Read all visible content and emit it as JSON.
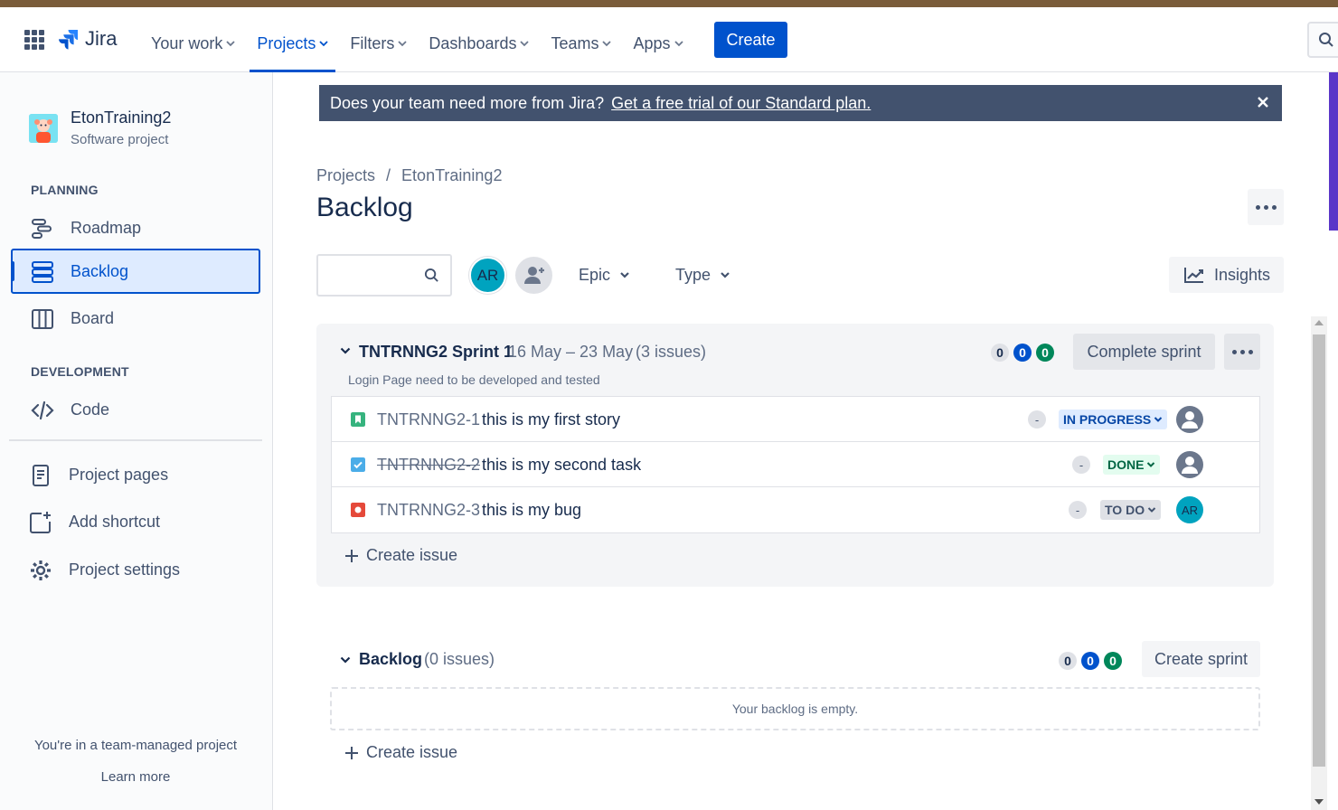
{
  "nav": {
    "logo": "Jira",
    "items": [
      {
        "label": "Your work",
        "active": false
      },
      {
        "label": "Projects",
        "active": true
      },
      {
        "label": "Filters",
        "active": false
      },
      {
        "label": "Dashboards",
        "active": false
      },
      {
        "label": "Teams",
        "active": false
      },
      {
        "label": "Apps",
        "active": false
      }
    ],
    "create_label": "Create"
  },
  "sidebar": {
    "project_name": "EtonTraining2",
    "project_type": "Software project",
    "planning_title": "PLANNING",
    "planning_items": [
      {
        "label": "Roadmap",
        "icon": "roadmap-icon",
        "active": false
      },
      {
        "label": "Backlog",
        "icon": "backlog-icon",
        "active": true
      },
      {
        "label": "Board",
        "icon": "board-icon",
        "active": false
      }
    ],
    "development_title": "DEVELOPMENT",
    "development_items": [
      {
        "label": "Code",
        "icon": "code-icon"
      }
    ],
    "extra_items": [
      {
        "label": "Project pages",
        "icon": "pages-icon"
      },
      {
        "label": "Add shortcut",
        "icon": "add-shortcut-icon"
      },
      {
        "label": "Project settings",
        "icon": "gear-icon"
      }
    ],
    "footer_text": "You're in a team-managed project",
    "learn_more": "Learn more"
  },
  "banner": {
    "text": "Does your team need more from Jira?",
    "link": "Get a free trial of our Standard plan."
  },
  "breadcrumb": [
    "Projects",
    "EtonTraining2"
  ],
  "page_title": "Backlog",
  "filters": {
    "search_placeholder": "",
    "avatar_initials": "AR",
    "epic_label": "Epic",
    "type_label": "Type",
    "insights_label": "Insights"
  },
  "sprint": {
    "name": "TNTRNNG2 Sprint 1",
    "dates": "16 May – 23 May",
    "count": "(3 issues)",
    "goal": "Login Page need to be developed and tested",
    "badge_todo": "0",
    "badge_inprogress": "0",
    "badge_done": "0",
    "complete_label": "Complete sprint",
    "issues": [
      {
        "key": "TNTRNNG2-1",
        "summary": "this is my first story",
        "type": "story",
        "estimate": "-",
        "status": "IN PROGRESS",
        "assignee": ""
      },
      {
        "key": "TNTRNNG2-2",
        "summary": "this is my second task",
        "type": "task",
        "estimate": "-",
        "status": "DONE",
        "assignee": ""
      },
      {
        "key": "TNTRNNG2-3",
        "summary": "this is my bug",
        "type": "bug",
        "estimate": "-",
        "status": "TO DO",
        "assignee": "AR"
      }
    ],
    "create_issue_label": "Create issue"
  },
  "backlog": {
    "name": "Backlog",
    "count": "(0 issues)",
    "badge_todo": "0",
    "badge_inprogress": "0",
    "badge_done": "0",
    "create_sprint_label": "Create sprint",
    "empty_text": "Your backlog is empty.",
    "create_issue_label": "Create issue"
  },
  "colors": {
    "brand": "#0052cc",
    "banner": "#42526e",
    "inprogress_bg": "#deebff",
    "done_bg": "#e3fcef",
    "todo_bg": "#dfe1e6"
  }
}
